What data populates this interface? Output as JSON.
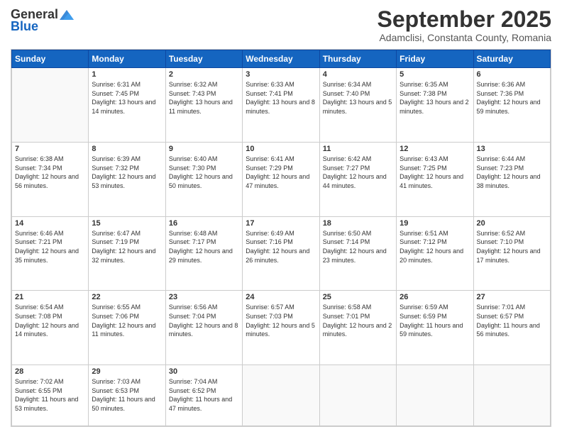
{
  "logo": {
    "general": "General",
    "blue": "Blue"
  },
  "header": {
    "month": "September 2025",
    "location": "Adamclisi, Constanta County, Romania"
  },
  "weekdays": [
    "Sunday",
    "Monday",
    "Tuesday",
    "Wednesday",
    "Thursday",
    "Friday",
    "Saturday"
  ],
  "weeks": [
    [
      {
        "day": "",
        "sunrise": "",
        "sunset": "",
        "daylight": ""
      },
      {
        "day": "1",
        "sunrise": "Sunrise: 6:31 AM",
        "sunset": "Sunset: 7:45 PM",
        "daylight": "Daylight: 13 hours and 14 minutes."
      },
      {
        "day": "2",
        "sunrise": "Sunrise: 6:32 AM",
        "sunset": "Sunset: 7:43 PM",
        "daylight": "Daylight: 13 hours and 11 minutes."
      },
      {
        "day": "3",
        "sunrise": "Sunrise: 6:33 AM",
        "sunset": "Sunset: 7:41 PM",
        "daylight": "Daylight: 13 hours and 8 minutes."
      },
      {
        "day": "4",
        "sunrise": "Sunrise: 6:34 AM",
        "sunset": "Sunset: 7:40 PM",
        "daylight": "Daylight: 13 hours and 5 minutes."
      },
      {
        "day": "5",
        "sunrise": "Sunrise: 6:35 AM",
        "sunset": "Sunset: 7:38 PM",
        "daylight": "Daylight: 13 hours and 2 minutes."
      },
      {
        "day": "6",
        "sunrise": "Sunrise: 6:36 AM",
        "sunset": "Sunset: 7:36 PM",
        "daylight": "Daylight: 12 hours and 59 minutes."
      }
    ],
    [
      {
        "day": "7",
        "sunrise": "Sunrise: 6:38 AM",
        "sunset": "Sunset: 7:34 PM",
        "daylight": "Daylight: 12 hours and 56 minutes."
      },
      {
        "day": "8",
        "sunrise": "Sunrise: 6:39 AM",
        "sunset": "Sunset: 7:32 PM",
        "daylight": "Daylight: 12 hours and 53 minutes."
      },
      {
        "day": "9",
        "sunrise": "Sunrise: 6:40 AM",
        "sunset": "Sunset: 7:30 PM",
        "daylight": "Daylight: 12 hours and 50 minutes."
      },
      {
        "day": "10",
        "sunrise": "Sunrise: 6:41 AM",
        "sunset": "Sunset: 7:29 PM",
        "daylight": "Daylight: 12 hours and 47 minutes."
      },
      {
        "day": "11",
        "sunrise": "Sunrise: 6:42 AM",
        "sunset": "Sunset: 7:27 PM",
        "daylight": "Daylight: 12 hours and 44 minutes."
      },
      {
        "day": "12",
        "sunrise": "Sunrise: 6:43 AM",
        "sunset": "Sunset: 7:25 PM",
        "daylight": "Daylight: 12 hours and 41 minutes."
      },
      {
        "day": "13",
        "sunrise": "Sunrise: 6:44 AM",
        "sunset": "Sunset: 7:23 PM",
        "daylight": "Daylight: 12 hours and 38 minutes."
      }
    ],
    [
      {
        "day": "14",
        "sunrise": "Sunrise: 6:46 AM",
        "sunset": "Sunset: 7:21 PM",
        "daylight": "Daylight: 12 hours and 35 minutes."
      },
      {
        "day": "15",
        "sunrise": "Sunrise: 6:47 AM",
        "sunset": "Sunset: 7:19 PM",
        "daylight": "Daylight: 12 hours and 32 minutes."
      },
      {
        "day": "16",
        "sunrise": "Sunrise: 6:48 AM",
        "sunset": "Sunset: 7:17 PM",
        "daylight": "Daylight: 12 hours and 29 minutes."
      },
      {
        "day": "17",
        "sunrise": "Sunrise: 6:49 AM",
        "sunset": "Sunset: 7:16 PM",
        "daylight": "Daylight: 12 hours and 26 minutes."
      },
      {
        "day": "18",
        "sunrise": "Sunrise: 6:50 AM",
        "sunset": "Sunset: 7:14 PM",
        "daylight": "Daylight: 12 hours and 23 minutes."
      },
      {
        "day": "19",
        "sunrise": "Sunrise: 6:51 AM",
        "sunset": "Sunset: 7:12 PM",
        "daylight": "Daylight: 12 hours and 20 minutes."
      },
      {
        "day": "20",
        "sunrise": "Sunrise: 6:52 AM",
        "sunset": "Sunset: 7:10 PM",
        "daylight": "Daylight: 12 hours and 17 minutes."
      }
    ],
    [
      {
        "day": "21",
        "sunrise": "Sunrise: 6:54 AM",
        "sunset": "Sunset: 7:08 PM",
        "daylight": "Daylight: 12 hours and 14 minutes."
      },
      {
        "day": "22",
        "sunrise": "Sunrise: 6:55 AM",
        "sunset": "Sunset: 7:06 PM",
        "daylight": "Daylight: 12 hours and 11 minutes."
      },
      {
        "day": "23",
        "sunrise": "Sunrise: 6:56 AM",
        "sunset": "Sunset: 7:04 PM",
        "daylight": "Daylight: 12 hours and 8 minutes."
      },
      {
        "day": "24",
        "sunrise": "Sunrise: 6:57 AM",
        "sunset": "Sunset: 7:03 PM",
        "daylight": "Daylight: 12 hours and 5 minutes."
      },
      {
        "day": "25",
        "sunrise": "Sunrise: 6:58 AM",
        "sunset": "Sunset: 7:01 PM",
        "daylight": "Daylight: 12 hours and 2 minutes."
      },
      {
        "day": "26",
        "sunrise": "Sunrise: 6:59 AM",
        "sunset": "Sunset: 6:59 PM",
        "daylight": "Daylight: 11 hours and 59 minutes."
      },
      {
        "day": "27",
        "sunrise": "Sunrise: 7:01 AM",
        "sunset": "Sunset: 6:57 PM",
        "daylight": "Daylight: 11 hours and 56 minutes."
      }
    ],
    [
      {
        "day": "28",
        "sunrise": "Sunrise: 7:02 AM",
        "sunset": "Sunset: 6:55 PM",
        "daylight": "Daylight: 11 hours and 53 minutes."
      },
      {
        "day": "29",
        "sunrise": "Sunrise: 7:03 AM",
        "sunset": "Sunset: 6:53 PM",
        "daylight": "Daylight: 11 hours and 50 minutes."
      },
      {
        "day": "30",
        "sunrise": "Sunrise: 7:04 AM",
        "sunset": "Sunset: 6:52 PM",
        "daylight": "Daylight: 11 hours and 47 minutes."
      },
      {
        "day": "",
        "sunrise": "",
        "sunset": "",
        "daylight": ""
      },
      {
        "day": "",
        "sunrise": "",
        "sunset": "",
        "daylight": ""
      },
      {
        "day": "",
        "sunrise": "",
        "sunset": "",
        "daylight": ""
      },
      {
        "day": "",
        "sunrise": "",
        "sunset": "",
        "daylight": ""
      }
    ]
  ]
}
